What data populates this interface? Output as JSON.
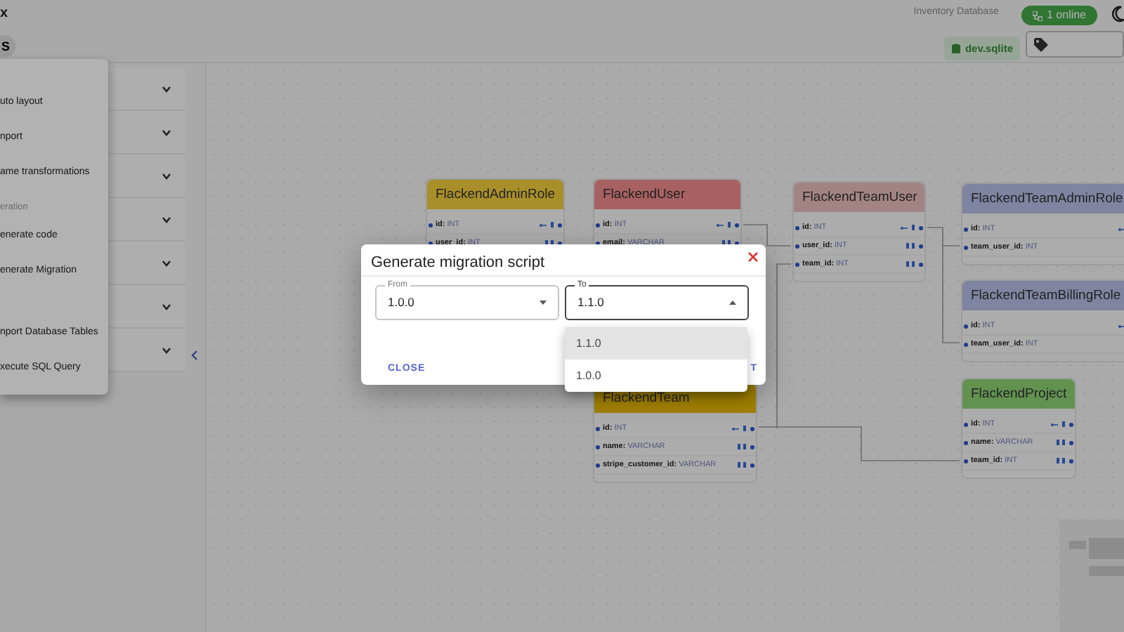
{
  "header": {
    "title": "x",
    "workspace_button": "S",
    "database_name": "Inventory Database",
    "online_badge": "1 online",
    "file_badge": "dev.sqlite"
  },
  "side_panel": {
    "sections": [
      {
        "expanded": false
      },
      {
        "expanded": false
      },
      {
        "expanded": false
      },
      {
        "expanded": false
      },
      {
        "expanded": false
      },
      {
        "expanded": false
      },
      {
        "expanded": false
      }
    ]
  },
  "menu": {
    "items": [
      {
        "kind": "item",
        "label": "uto layout"
      },
      {
        "kind": "item",
        "label": "nport"
      },
      {
        "kind": "item",
        "label": "ame transformations"
      },
      {
        "kind": "header",
        "label": "eration"
      },
      {
        "kind": "item",
        "label": "enerate code"
      },
      {
        "kind": "item",
        "label": "enerate Migration"
      },
      {
        "kind": "spacer"
      },
      {
        "kind": "item",
        "label": "nport Database Tables"
      },
      {
        "kind": "item",
        "label": "xecute SQL Query"
      }
    ]
  },
  "diagram": {
    "tables": [
      {
        "title": "FlackendAdminRole",
        "color": "#a98f29",
        "fields": [
          {
            "name": "id:",
            "type": "INT",
            "key": true
          },
          {
            "name": "user_id:",
            "type": "INT",
            "key": false
          }
        ]
      },
      {
        "title": "FlackendUser",
        "color": "#a86161",
        "fields": [
          {
            "name": "id:",
            "type": "INT",
            "key": true
          },
          {
            "name": "email:",
            "type": "VARCHAR",
            "key": false
          }
        ]
      },
      {
        "title": "FlackendTeamUser",
        "color": "#a38484",
        "fields": [
          {
            "name": "id:",
            "type": "INT",
            "key": true
          },
          {
            "name": "user_id:",
            "type": "INT",
            "key": false
          },
          {
            "name": "team_id:",
            "type": "INT",
            "key": false
          }
        ]
      },
      {
        "title": "FlackendTeamAdminRole",
        "color": "#7f84a1",
        "fields": [
          {
            "name": "id:",
            "type": "INT",
            "key": true
          },
          {
            "name": "team_user_id:",
            "type": "INT",
            "key": false
          }
        ]
      },
      {
        "title": "FlackendTeamBillingRole",
        "color": "#7f84a1",
        "fields": [
          {
            "name": "id:",
            "type": "INT",
            "key": true
          },
          {
            "name": "team_user_id:",
            "type": "INT",
            "key": false
          }
        ]
      },
      {
        "title": "FlackendTeam",
        "color": "#a28200",
        "fields": [
          {
            "name": "id:",
            "type": "INT",
            "key": true
          },
          {
            "name": "name:",
            "type": "VARCHAR",
            "key": false
          },
          {
            "name": "stripe_customer_id:",
            "type": "VARCHAR",
            "key": false
          }
        ]
      },
      {
        "title": "FlackendProject",
        "color": "#639250",
        "fields": [
          {
            "name": "id:",
            "type": "INT",
            "key": true
          },
          {
            "name": "name:",
            "type": "VARCHAR",
            "key": false
          },
          {
            "name": "team_id:",
            "type": "INT",
            "key": false
          }
        ]
      }
    ]
  },
  "dialog": {
    "title": "Generate migration script",
    "selects": [
      {
        "label": "From",
        "value": "1.0.0",
        "open": false
      },
      {
        "label": "To",
        "value": "1.1.0",
        "open": true
      }
    ],
    "options": [
      {
        "label": "1.1.0",
        "selected": true
      },
      {
        "label": "1.0.0",
        "selected": false
      }
    ],
    "actions": [
      {
        "label": "CLOSE"
      },
      {
        "label": "T"
      }
    ]
  }
}
